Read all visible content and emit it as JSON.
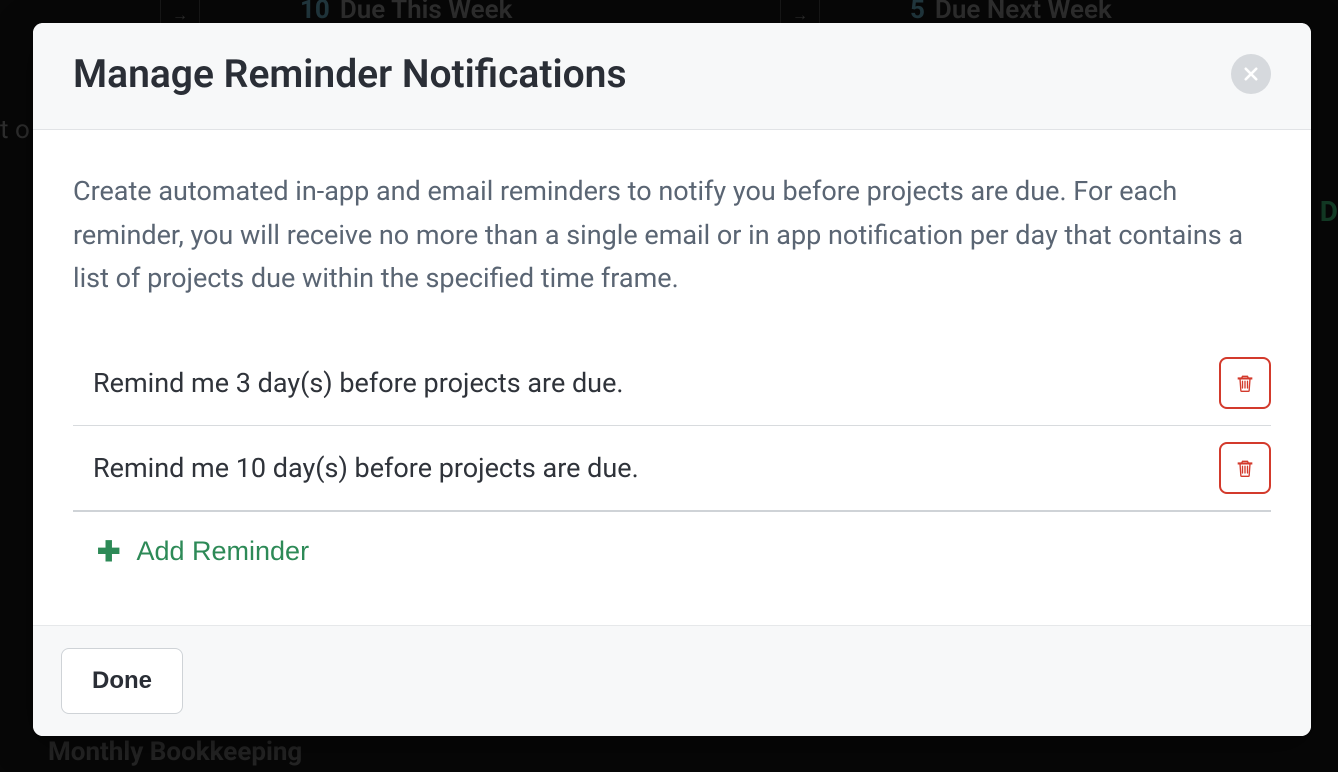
{
  "backdrop": {
    "due_this_week_count": "10",
    "due_this_week_label": "Due This Week",
    "due_next_week_count": "5",
    "due_next_week_label": "Due Next Week",
    "left_fragment": "t o",
    "right_fragment": "D",
    "bottom_label": "Monthly Bookkeeping"
  },
  "modal": {
    "title": "Manage Reminder Notifications",
    "description": "Create automated in-app and email reminders to notify you before projects are due. For each reminder, you will receive no more than a single email or in app notification per day that contains a list of projects due within the specified time frame.",
    "reminders": [
      {
        "text": "Remind me 3 day(s) before projects are due."
      },
      {
        "text": "Remind me 10 day(s) before projects are due."
      }
    ],
    "add_label": "Add Reminder",
    "done_label": "Done"
  }
}
